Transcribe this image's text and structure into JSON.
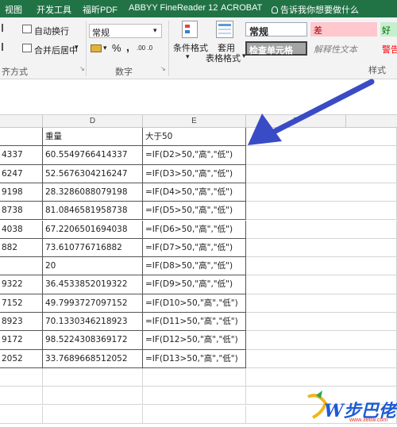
{
  "tabs": [
    "视图",
    "开发工具",
    "福昕PDF",
    "ABBYY FineReader 12",
    "ACROBAT",
    "告诉我你想要做什么"
  ],
  "ribbon": {
    "wrap_text": "自动换行",
    "merge_center": "合并后居中",
    "alignment_group": "齐方式",
    "number_format": "常规",
    "percent": "%",
    "comma": ",",
    "dec_inc": ".00 .0",
    "number_group": "数字",
    "conditional_format": "条件格式",
    "table_format_1": "套用",
    "table_format_2": "表格格式",
    "style_normal": "常规",
    "style_bad": "差",
    "style_good": "好",
    "style_check": "检查单元格",
    "style_explanatory": "解释性文本",
    "style_warning": "警告",
    "style_group": "样式"
  },
  "columns": [
    "D",
    "E",
    "F"
  ],
  "rows": [
    {
      "c": "",
      "d": "重量",
      "e": "大于50"
    },
    {
      "c": "4337",
      "d": "60.5549766414337",
      "e": "=IF(D2>50,\"高\",\"低\")"
    },
    {
      "c": "6247",
      "d": "52.5676304216247",
      "e": "=IF(D3>50,\"高\",\"低\")"
    },
    {
      "c": "9198",
      "d": "28.3286088079198",
      "e": "=IF(D4>50,\"高\",\"低\")"
    },
    {
      "c": "8738",
      "d": "81.0846581958738",
      "e": "=IF(D5>50,\"高\",\"低\")"
    },
    {
      "c": "4038",
      "d": "67.2206501694038",
      "e": "=IF(D6>50,\"高\",\"低\")"
    },
    {
      "c": "882",
      "d": "73.610776716882",
      "e": "=IF(D7>50,\"高\",\"低\")"
    },
    {
      "c": "",
      "d": "20",
      "e": "=IF(D8>50,\"高\",\"低\")"
    },
    {
      "c": "9322",
      "d": "36.4533852019322",
      "e": "=IF(D9>50,\"高\",\"低\")"
    },
    {
      "c": "7152",
      "d": "49.7993727097152",
      "e": "=IF(D10>50,\"高\",\"低\")"
    },
    {
      "c": "8923",
      "d": "70.1330346218923",
      "e": "=IF(D11>50,\"高\",\"低\")"
    },
    {
      "c": "9172",
      "d": "98.5224308369172",
      "e": "=IF(D12>50,\"高\",\"低\")"
    },
    {
      "c": "2052",
      "d": "33.7689668512052",
      "e": "=IF(D13>50,\"高\",\"低\")"
    },
    {
      "c": "",
      "d": "",
      "e": ""
    },
    {
      "c": "",
      "d": "",
      "e": ""
    },
    {
      "c": "",
      "d": "",
      "e": ""
    }
  ],
  "watermark": {
    "text": "W步巴佬",
    "url": "www.386w.com"
  },
  "colors": {
    "ribbon_tab_bg": "#217346",
    "arrow": "#3a4bc6",
    "bad_bg": "#ffc7ce",
    "good_bg": "#c6efce"
  }
}
